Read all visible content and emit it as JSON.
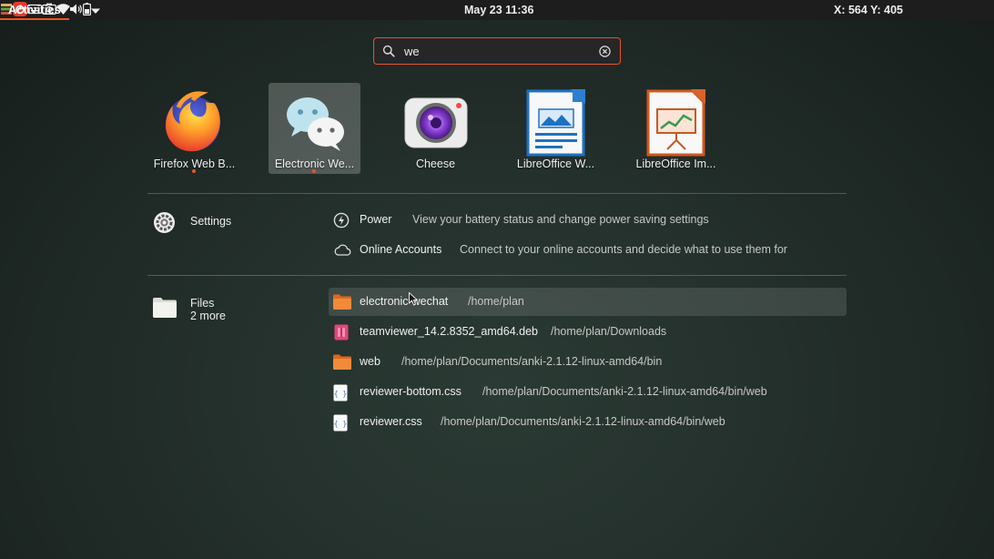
{
  "topbar": {
    "activities": "Activities",
    "clock": "May 23  11:36",
    "coordinates": "X: 564 Y: 405",
    "tray_icons": [
      "stacked-books-icon",
      "netease-music-icon",
      "keyboard-icon",
      "screenshot-camera-icon",
      "wifi-icon",
      "volume-icon",
      "battery-icon",
      "chevron-down-icon"
    ]
  },
  "search": {
    "value": "we"
  },
  "apps": [
    {
      "label": "Firefox Web B...",
      "icon": "firefox-icon",
      "running": true,
      "selected": false
    },
    {
      "label": "Electronic We...",
      "icon": "wechat-icon",
      "running": true,
      "selected": true
    },
    {
      "label": "Cheese",
      "icon": "cheese-webcam-icon",
      "running": false,
      "selected": false
    },
    {
      "label": "LibreOffice W...",
      "icon": "libreoffice-writer-icon",
      "running": false,
      "selected": false
    },
    {
      "label": "LibreOffice Im...",
      "icon": "libreoffice-impress-icon",
      "running": false,
      "selected": false
    }
  ],
  "settings_provider": {
    "name": "Settings",
    "results": [
      {
        "name": "Power",
        "description": "View your battery status and change power saving settings",
        "icon": "power-icon"
      },
      {
        "name": "Online Accounts",
        "description": "Connect to your online accounts and decide what to use them for",
        "icon": "cloud-icon"
      }
    ]
  },
  "files_provider": {
    "name": "Files",
    "more": "2 more",
    "results": [
      {
        "name": "electronic-wechat",
        "path": "/home/plan",
        "icon": "folder-icon"
      },
      {
        "name": "teamviewer_14.2.8352_amd64.deb",
        "path": "/home/plan/Downloads",
        "icon": "deb-package-icon"
      },
      {
        "name": "web",
        "path": "/home/plan/Documents/anki-2.1.12-linux-amd64/bin",
        "icon": "folder-icon"
      },
      {
        "name": "reviewer-bottom.css",
        "path": "/home/plan/Documents/anki-2.1.12-linux-amd64/bin/web",
        "icon": "css-file-icon"
      },
      {
        "name": "reviewer.css",
        "path": "/home/plan/Documents/anki-2.1.12-linux-amd64/bin/web",
        "icon": "css-file-icon"
      }
    ]
  },
  "colors": {
    "accent": "#e95420",
    "topbar_bg": "#1d1d1d"
  }
}
